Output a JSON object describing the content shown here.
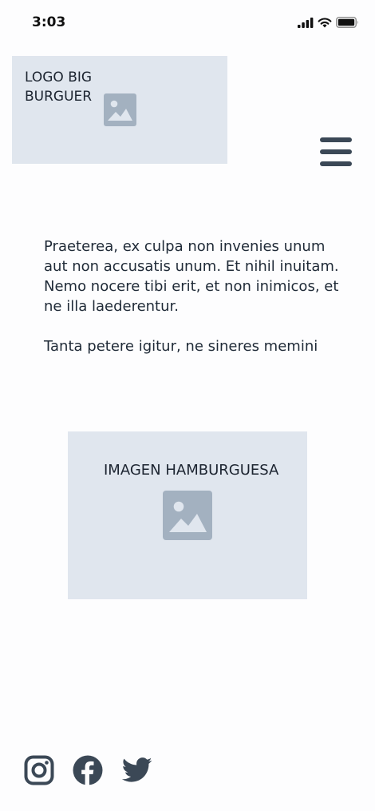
{
  "status_bar": {
    "time": "3:03",
    "icons": [
      "cellular-signal-icon",
      "wifi-icon",
      "battery-icon"
    ]
  },
  "header": {
    "logo_text": "LOGO BIG\nBURGUER",
    "logo_icon": "image-placeholder-icon",
    "menu_icon": "hamburger-menu-icon"
  },
  "main": {
    "paragraphs": [
      "Praeterea, ex culpa non invenies unum aut non accusatis unum. Et nihil inuitam. Nemo nocere tibi erit, et non inimicos, et ne illa laederentur.",
      "Tanta petere igitur, ne sineres memini"
    ],
    "hero_label": "IMAGEN HAMBURGUESA",
    "hero_icon": "image-placeholder-icon"
  },
  "footer": {
    "social": [
      "instagram-icon",
      "facebook-icon",
      "twitter-icon"
    ]
  },
  "colors": {
    "placeholder_bg": "#e0e6ee",
    "placeholder_icon": "#a3b1c0",
    "icon_dark": "#3b4856",
    "text": "#1f2a37"
  }
}
